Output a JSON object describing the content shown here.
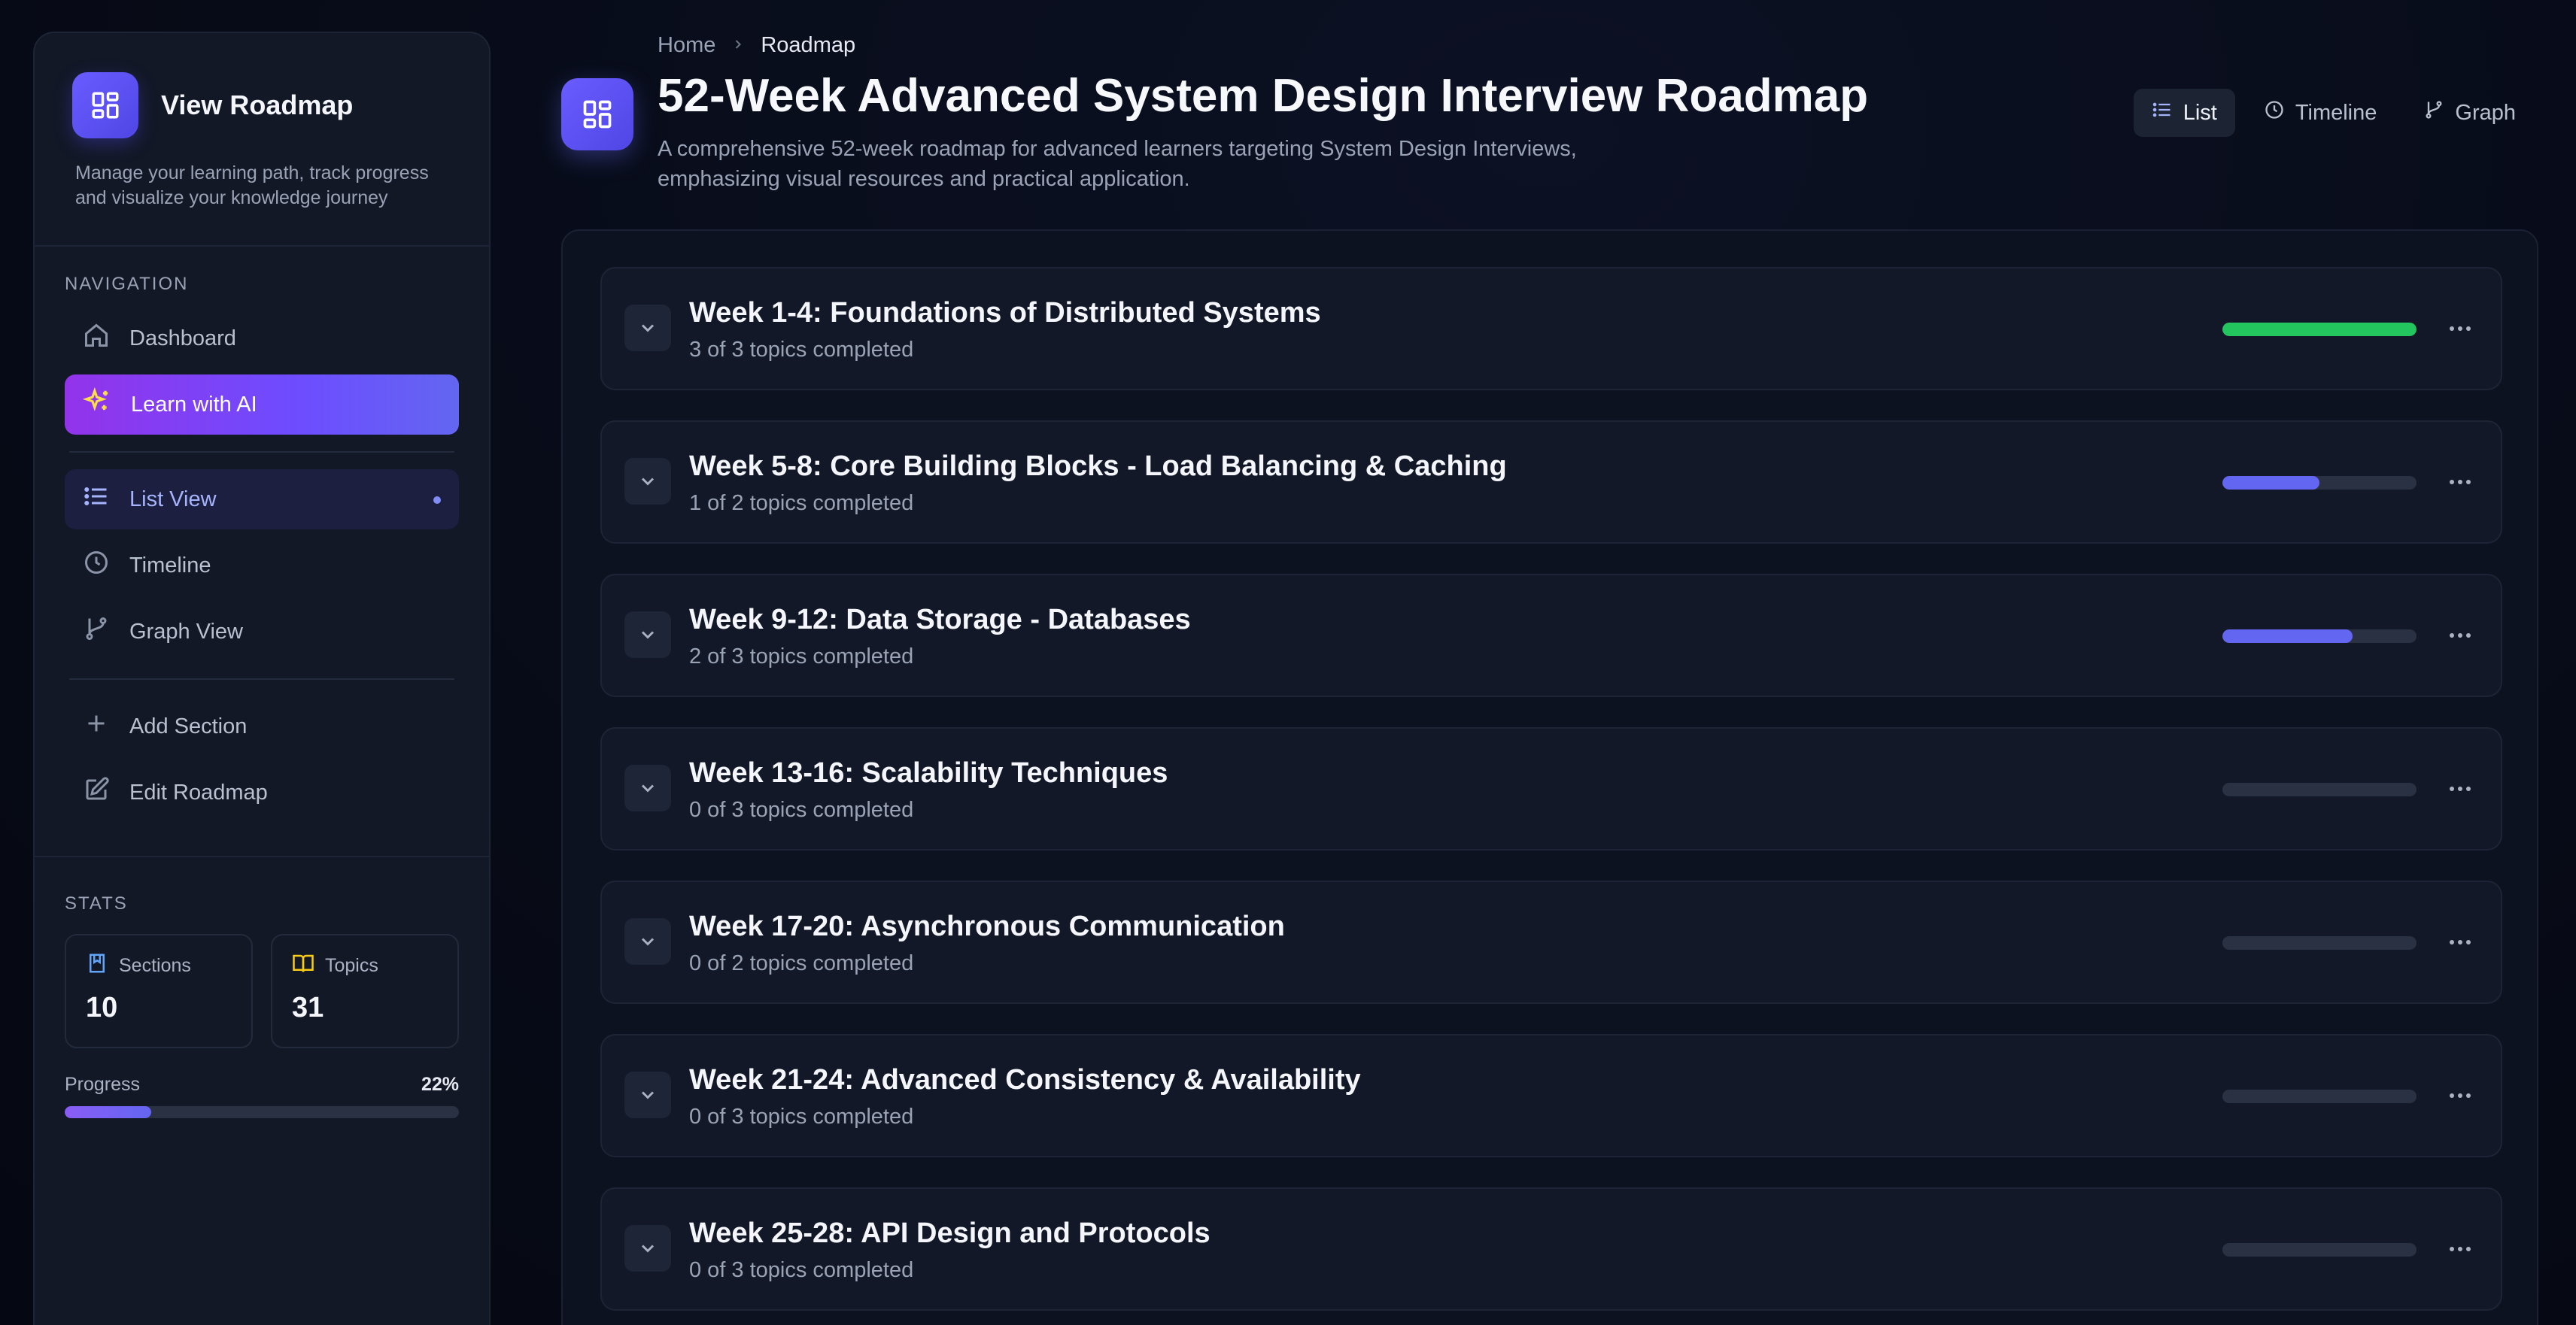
{
  "sidebar": {
    "title": "View Roadmap",
    "description": "Manage your learning path, track progress and visualize your knowledge journey",
    "nav_label": "NAVIGATION",
    "nav": [
      {
        "label": "Dashboard",
        "icon": "home-icon"
      },
      {
        "label": "Learn with AI",
        "icon": "sparkles-icon"
      }
    ],
    "views": [
      {
        "label": "List View",
        "icon": "list-icon",
        "active": true
      },
      {
        "label": "Timeline",
        "icon": "clock-icon"
      },
      {
        "label": "Graph View",
        "icon": "git-branch-icon"
      }
    ],
    "actions": [
      {
        "label": "Add Section",
        "icon": "plus-icon"
      },
      {
        "label": "Edit Roadmap",
        "icon": "edit-icon"
      }
    ],
    "stats_label": "STATS",
    "stats": {
      "sections_label": "Sections",
      "sections_value": "10",
      "topics_label": "Topics",
      "topics_value": "31",
      "progress_label": "Progress",
      "progress_value": "22%",
      "progress_fraction": 0.22
    }
  },
  "header": {
    "breadcrumb": [
      "Home",
      "Roadmap"
    ],
    "title": "52-Week Advanced System Design Interview Roadmap",
    "description": "A comprehensive 52-week roadmap for advanced learners targeting System Design Interviews, emphasizing visual resources and practical application.",
    "views": [
      "List",
      "Timeline",
      "Graph"
    ],
    "active_view": "List"
  },
  "sections": [
    {
      "title": "Week 1-4: Foundations of Distributed Systems",
      "status": "3 of 3 topics completed",
      "progress": 1.0,
      "color": "#22c55e"
    },
    {
      "title": "Week 5-8: Core Building Blocks - Load Balancing & Caching",
      "status": "1 of 2 topics completed",
      "progress": 0.5,
      "color": "#6366f1"
    },
    {
      "title": "Week 9-12: Data Storage - Databases",
      "status": "2 of 3 topics completed",
      "progress": 0.67,
      "color": "#6366f1"
    },
    {
      "title": "Week 13-16: Scalability Techniques",
      "status": "0 of 3 topics completed",
      "progress": 0,
      "color": "#6366f1"
    },
    {
      "title": "Week 17-20: Asynchronous Communication",
      "status": "0 of 2 topics completed",
      "progress": 0,
      "color": "#6366f1"
    },
    {
      "title": "Week 21-24: Advanced Consistency & Availability",
      "status": "0 of 3 topics completed",
      "progress": 0,
      "color": "#6366f1"
    },
    {
      "title": "Week 25-28: API Design and Protocols",
      "status": "0 of 3 topics completed",
      "progress": 0,
      "color": "#6366f1"
    }
  ],
  "colors": {
    "accent": "#6366f1",
    "success": "#22c55e",
    "ai_gradient_start": "#9333ea"
  }
}
